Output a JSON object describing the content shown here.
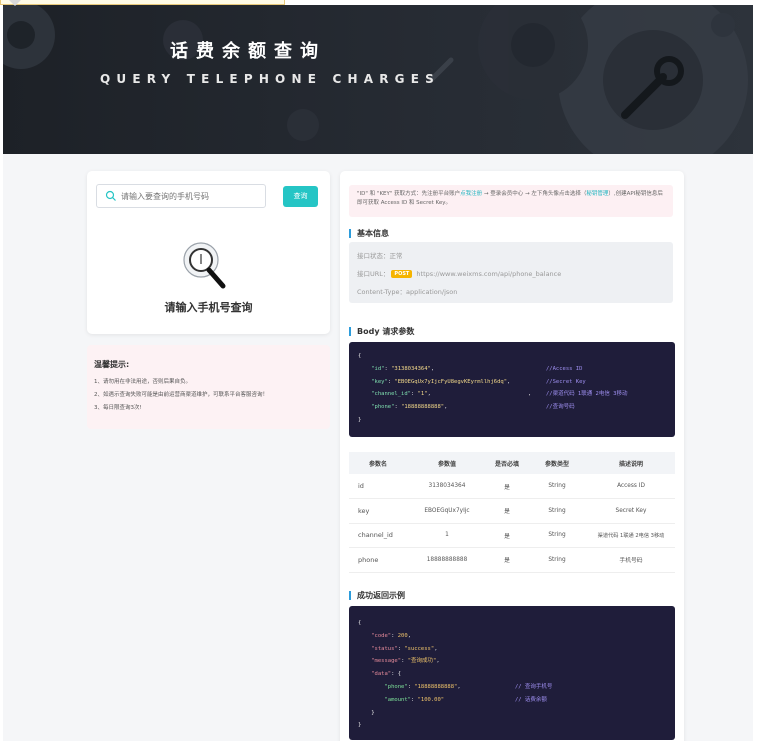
{
  "banner": {
    "title": "话费余额查询",
    "subtitle": "QUERY TELEPHONE CHARGES"
  },
  "search": {
    "placeholder": "请输入要查询的手机号码",
    "button_label": "查询",
    "empty_text": "请输入手机号查询"
  },
  "tips": {
    "title": "温馨提示:",
    "items": [
      "1、请勿用在非法用途，否则后果自负。",
      "2、如遇示查询失败可能是由前运营商渠道维护，可联系平台客服咨询！",
      "3、每日限查询3次!"
    ]
  },
  "notice": {
    "p1": "\"ID\" 和 \"KEY\" 获取方式：先注册平台账户",
    "link1": "点我注册",
    "p2": " → 登录会员中心 → 左下角头像点击选择（",
    "link2": "秘钥管理",
    "p3": "）,创建API秘钥信息后即可获取 Access ID 和 Secret Key。"
  },
  "basic_info": {
    "title": "基本信息",
    "status": "接口状态：正常",
    "url_label": "接口URL：",
    "method": "POST",
    "url": "https://www.weixms.com/api/phone_balance",
    "content_type": "Content-Type：application/json"
  },
  "body_params": {
    "title": "Body 请求参数",
    "lines": [
      {
        "k": "\"id\"",
        "v": "\"3138034364\"",
        "c": "//Access ID"
      },
      {
        "k": "\"key\"",
        "v": "\"EBOEGqUx7yIjcFyU8egvKEyrmllhj6dq\"",
        "c": "//Secret Key"
      },
      {
        "k": "\"channel_id\"",
        "v": "\"1\"",
        "c": "//渠道代码 1联通 2电信 3移动"
      },
      {
        "k": "\"phone\"",
        "v": "\"18888888888\"",
        "c": "//查询号码"
      }
    ]
  },
  "param_table": {
    "headers": [
      "参数名",
      "参数值",
      "是否必填",
      "参数类型",
      "描述说明"
    ],
    "rows": [
      [
        "id",
        "3138034364",
        "是",
        "String",
        "Access ID"
      ],
      [
        "key",
        "EBOEGqUx7yIjc",
        "是",
        "String",
        "Secret Key"
      ],
      [
        "channel_id",
        "1",
        "是",
        "String",
        "渠道代码 1联通 2电信 3移动"
      ],
      [
        "phone",
        "18888888888",
        "是",
        "String",
        "手机号码"
      ]
    ]
  },
  "response_example": {
    "title": "成功返回示例",
    "code_key": "\"code\"",
    "code_val": "200",
    "status_key": "\"status\"",
    "status_val": "\"success\"",
    "message_key": "\"message\"",
    "message_val": "\"查询成功\"",
    "data_key": "\"data\"",
    "phone_key": "\"phone\"",
    "phone_val": "\"18888888888\"",
    "phone_comment": "// 查询手机号",
    "amount_key": "\"amount\"",
    "amount_val": "\"100.00\"",
    "amount_comment": "// 话费余额"
  },
  "colors": {
    "accent": "#25c5c5",
    "banner_bg": "#1f2329",
    "code_bg": "#1f1d3a",
    "post_tag": "#f5b400"
  }
}
